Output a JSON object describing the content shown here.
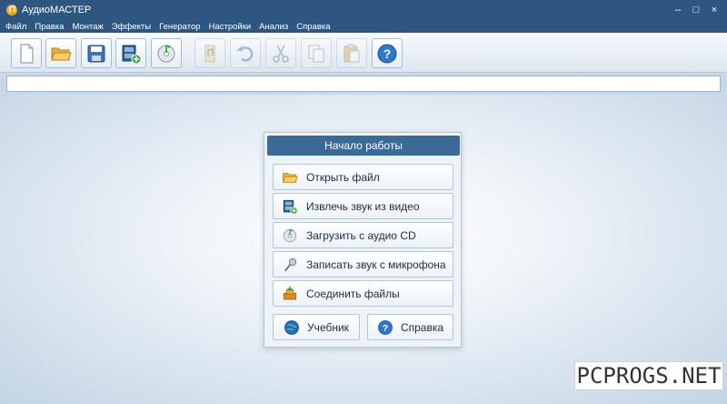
{
  "window": {
    "title": "АудиоМАСТЕР",
    "controls": [
      "–",
      "□",
      "×"
    ]
  },
  "menu": [
    {
      "label": "Файл"
    },
    {
      "label": "Правка"
    },
    {
      "label": "Монтаж"
    },
    {
      "label": "Эффекты"
    },
    {
      "label": "Генератор"
    },
    {
      "label": "Настройки"
    },
    {
      "label": "Анализ"
    },
    {
      "label": "Справка"
    }
  ],
  "toolbar": {
    "buttons": [
      {
        "icon": "new-file-icon",
        "enabled": true
      },
      {
        "icon": "open-folder-icon",
        "enabled": true
      },
      {
        "icon": "save-icon",
        "enabled": true
      },
      {
        "icon": "video-extract-icon",
        "enabled": true
      },
      {
        "icon": "audio-cd-icon",
        "enabled": true
      },
      {
        "icon": "audio-properties-icon",
        "enabled": false
      },
      {
        "icon": "undo-icon",
        "enabled": false
      },
      {
        "icon": "cut-icon",
        "enabled": false
      },
      {
        "icon": "copy-icon",
        "enabled": false
      },
      {
        "icon": "paste-icon",
        "enabled": false
      },
      {
        "icon": "help-icon",
        "enabled": true
      }
    ]
  },
  "start_panel": {
    "header": "Начало работы",
    "actions": [
      {
        "label": "Открыть файл",
        "icon": "open-folder-icon"
      },
      {
        "label": "Извлечь звук из видео",
        "icon": "video-extract-icon"
      },
      {
        "label": "Загрузить с аудио CD",
        "icon": "audio-cd-icon"
      },
      {
        "label": "Записать звук с микрофона",
        "icon": "microphone-icon"
      },
      {
        "label": "Соединить файлы",
        "icon": "join-files-icon"
      }
    ],
    "tutorial_label": "Учебник",
    "help_label": "Справка"
  },
  "watermark": "PCPROGS.NET",
  "colors": {
    "titlebar": "#2e5680",
    "panel_header": "#3c6a97",
    "workspace_center": "#ffffff",
    "workspace_edge": "#c4d4e3"
  }
}
